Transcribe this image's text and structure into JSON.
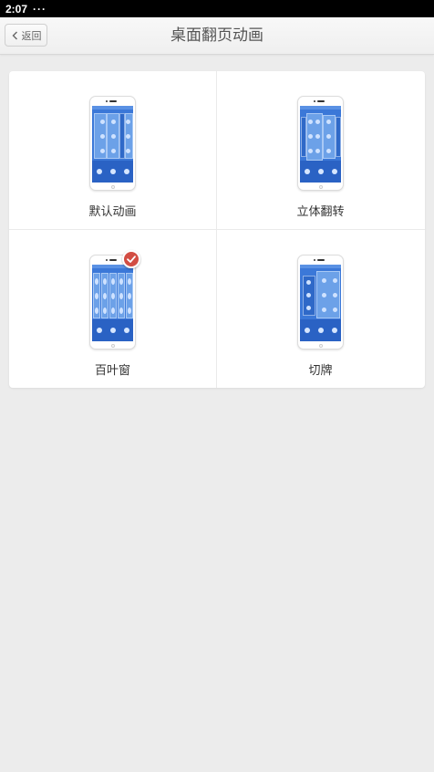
{
  "status_bar": {
    "time": "2:07",
    "dots": "···"
  },
  "header": {
    "back_label": "返回",
    "title": "桌面翻页动画"
  },
  "options": [
    {
      "label": "默认动画",
      "selected": false
    },
    {
      "label": "立体翻转",
      "selected": false
    },
    {
      "label": "百叶窗",
      "selected": true
    },
    {
      "label": "切牌",
      "selected": false
    }
  ],
  "colors": {
    "accent_check": "#d24d43",
    "screen_blue": "#3b78d8"
  },
  "icons": {
    "back": "chevron-left-icon",
    "selected": "checkmark-icon"
  }
}
